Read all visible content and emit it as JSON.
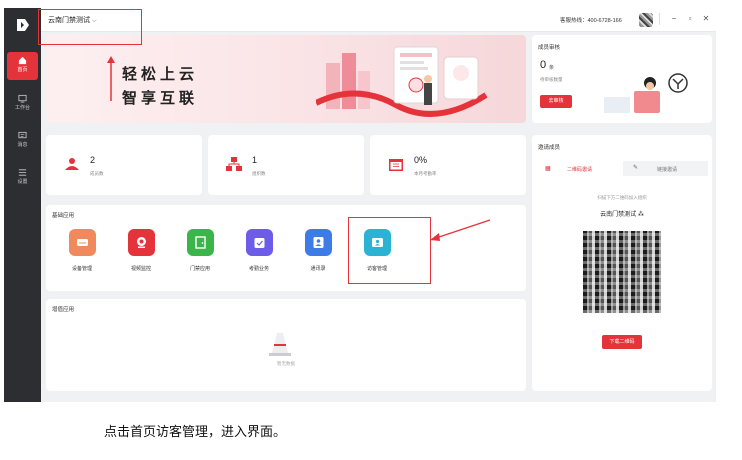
{
  "topbar": {
    "org_name": "云南门禁测试",
    "hotline": "客服热线：400-6728-166",
    "window_buttons": [
      "−",
      "▫",
      "✕"
    ]
  },
  "sidebar": {
    "items": [
      {
        "label": "首页",
        "icon": "home-icon",
        "active": true
      },
      {
        "label": "工作台",
        "icon": "monitor-icon",
        "active": false
      },
      {
        "label": "消息",
        "icon": "message-icon",
        "active": false
      },
      {
        "label": "设置",
        "icon": "settings-icon",
        "active": false
      }
    ]
  },
  "banner": {
    "line1": "轻松上云",
    "line2": "智享互联"
  },
  "stats": [
    {
      "value": "2",
      "label": "成员数",
      "icon": "people-icon"
    },
    {
      "value": "1",
      "label": "组织数",
      "icon": "org-icon"
    },
    {
      "value": "0%",
      "label": "本月考勤率",
      "icon": "calendar-icon"
    }
  ],
  "basic_apps": {
    "title": "基础应用",
    "items": [
      {
        "label": "设备管理",
        "color": "#f08a5d",
        "icon": "device-icon"
      },
      {
        "label": "视频监控",
        "color": "#e5333b",
        "icon": "camera-icon"
      },
      {
        "label": "门禁应用",
        "color": "#3bb54a",
        "icon": "door-icon"
      },
      {
        "label": "考勤业务",
        "color": "#6c5ce7",
        "icon": "attendance-icon"
      },
      {
        "label": "通讯录",
        "color": "#3d7be6",
        "icon": "contacts-icon"
      },
      {
        "label": "访客管理",
        "color": "#2bb3d3",
        "icon": "visitor-icon"
      }
    ]
  },
  "value_apps": {
    "title": "增值应用",
    "empty_text": "暂无数据"
  },
  "member_review": {
    "title": "成员审核",
    "count": "0",
    "unit": "条",
    "sub_label": "待审核数量",
    "button": "去审核"
  },
  "invite": {
    "title": "邀请成员",
    "tabs": [
      "二维码邀请",
      "链接邀请"
    ],
    "hint": "扫描下方二维码加入组织",
    "org_name": "云南门禁测试",
    "download_button": "下载二维码"
  },
  "caption": "点击首页访客管理，进入界面。",
  "colors": {
    "accent": "#e5333b",
    "sidebar": "#2d2e31",
    "highlight": "#e5333b"
  }
}
